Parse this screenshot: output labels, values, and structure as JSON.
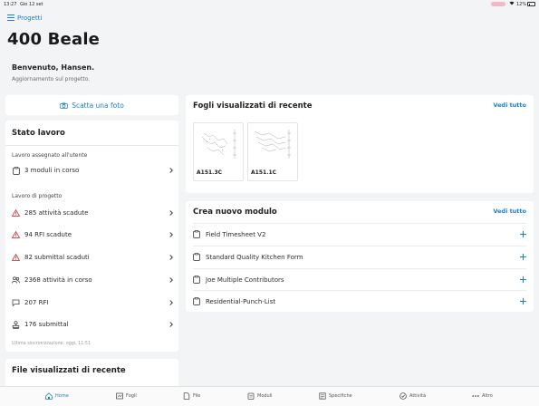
{
  "status_bar": {
    "time": "13:27",
    "date": "Gio 12 set",
    "battery": "12%"
  },
  "nav": {
    "projects_link": "Progetti"
  },
  "page": {
    "title": "400 Beale",
    "welcome": "Benvenuto, Hansen.",
    "welcome_sub": "Aggiornamento sul progetto."
  },
  "photo": {
    "label": "Scatta una foto"
  },
  "work_status": {
    "title": "Stato lavoro",
    "assigned_label": "Lavoro assegnato all'utente",
    "assigned_items": [
      {
        "label": "3 moduli in corso",
        "icon": "clipboard-icon"
      }
    ],
    "project_label": "Lavoro di progetto",
    "project_items": [
      {
        "label": "285 attività scadute",
        "icon": "warning-icon"
      },
      {
        "label": "94 RFI scadute",
        "icon": "warning-icon"
      },
      {
        "label": "82 submittal scaduti",
        "icon": "warning-icon"
      },
      {
        "label": "2368 attività in corso",
        "icon": "people-icon"
      },
      {
        "label": "207 RFI",
        "icon": "chat-icon"
      },
      {
        "label": "176 submittal",
        "icon": "stamp-icon"
      }
    ],
    "sync_note": "Ultima sincronizzazione: oggi, 11:51"
  },
  "recent_files": {
    "title": "File visualizzati di recente"
  },
  "recent_sheets": {
    "title": "Fogli visualizzati di recente",
    "see_all": "Vedi tutto",
    "sheets": [
      {
        "name": "A151.3C"
      },
      {
        "name": "A151.1C"
      }
    ]
  },
  "new_form": {
    "title": "Crea nuovo modulo",
    "see_all": "Vedi tutto",
    "forms": [
      {
        "label": "Field Timesheet V2"
      },
      {
        "label": "Standard Quality Kitchen Form"
      },
      {
        "label": "Joe Multiple Contributors"
      },
      {
        "label": "Residential-Punch-List"
      }
    ]
  },
  "tabbar": {
    "tabs": [
      {
        "label": "Home",
        "icon": "home-icon",
        "active": true
      },
      {
        "label": "Fogli",
        "icon": "sheets-icon",
        "active": false
      },
      {
        "label": "File",
        "icon": "file-icon",
        "active": false
      },
      {
        "label": "Moduli",
        "icon": "forms-icon",
        "active": false
      },
      {
        "label": "Specifiche",
        "icon": "specs-icon",
        "active": false
      },
      {
        "label": "Attività",
        "icon": "check-circle-icon",
        "active": false
      },
      {
        "label": "Altro",
        "icon": "more-icon",
        "active": false
      }
    ]
  },
  "colors": {
    "accent": "#1a7fc4",
    "warning": "#d93a3a",
    "background": "#f3f4f5",
    "card": "#ffffff"
  }
}
